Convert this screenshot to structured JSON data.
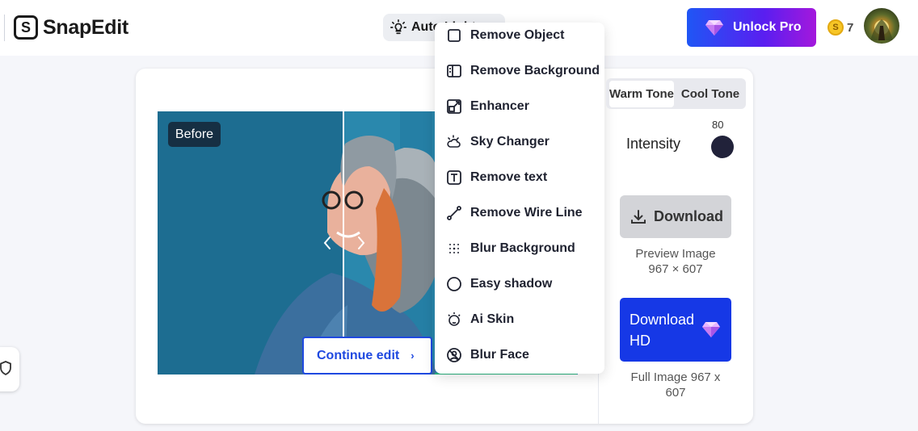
{
  "header": {
    "logo_mark": "S",
    "logo_text": "SnapEdit",
    "mode_selector_label": "Auto Light",
    "unlock_label": "Unlock Pro",
    "coin_symbol": "S",
    "coin_count": "7"
  },
  "editor": {
    "before_label": "Before",
    "continue_label": "Continue edit",
    "continue_chevron": "›"
  },
  "tools_menu": {
    "items": [
      {
        "label": "Remove Object",
        "icon": "remove-object-icon"
      },
      {
        "label": "Remove Background",
        "icon": "remove-background-icon"
      },
      {
        "label": "Enhancer",
        "icon": "enhancer-icon"
      },
      {
        "label": "Sky Changer",
        "icon": "sky-changer-icon"
      },
      {
        "label": "Remove text",
        "icon": "remove-text-icon"
      },
      {
        "label": "Remove Wire Line",
        "icon": "remove-wire-line-icon"
      },
      {
        "label": "Blur Background",
        "icon": "blur-background-icon"
      },
      {
        "label": "Easy shadow",
        "icon": "easy-shadow-icon"
      },
      {
        "label": "Ai Skin",
        "icon": "ai-skin-icon"
      },
      {
        "label": "Blur Face",
        "icon": "blur-face-icon"
      }
    ]
  },
  "panel": {
    "tone_options": [
      "Warm Tone",
      "Cool Tone"
    ],
    "selected_tone": "Warm Tone",
    "intensity_label": "Intensity",
    "intensity_value": "80",
    "download_label": "Download",
    "preview_label": "Preview Image",
    "preview_size": "967 × 607",
    "download_hd_label": "Download HD",
    "full_image_label": "Full Image 967 x 607"
  },
  "colors": {
    "accent_blue": "#1638e6",
    "unlock_gradient_start": "#1f56f5",
    "unlock_gradient_end": "#a418dc",
    "photo_background": "#1e6f93"
  }
}
